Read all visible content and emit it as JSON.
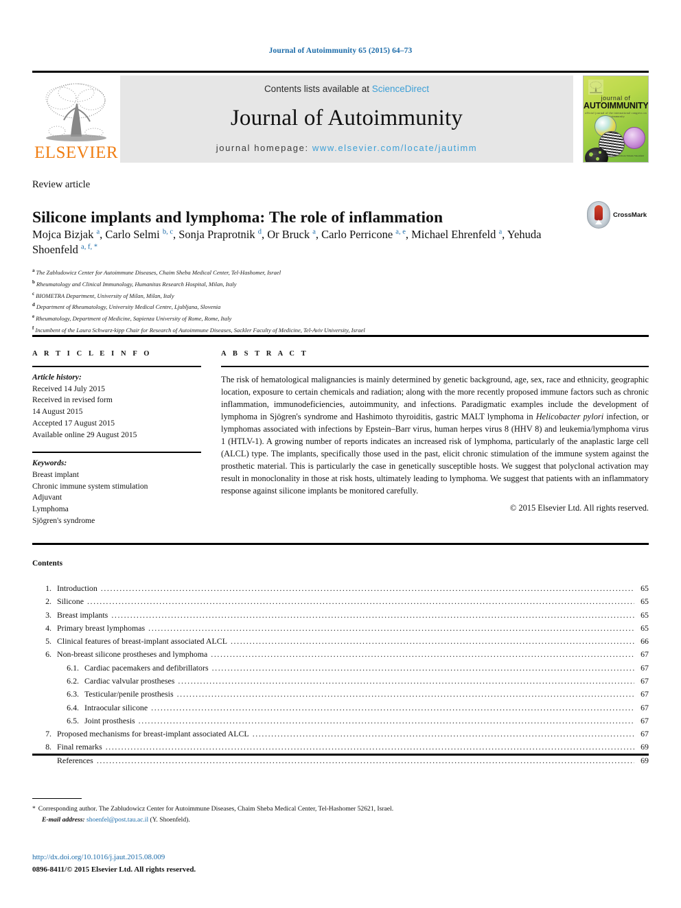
{
  "running_head": "Journal of Autoimmunity 65 (2015) 64–73",
  "masthead": {
    "contents_prefix": "Contents lists available at ",
    "sciencedirect": "ScienceDirect",
    "journal_title": "Journal of Autoimmunity",
    "homepage_prefix": "journal homepage: ",
    "homepage_url": "www.elsevier.com/locate/jautimm",
    "publisher_logo_text": "ELSEVIER",
    "cover": {
      "line1": "journal of",
      "line2": "AUTOIMMUNITY",
      "line3": "official journal of the international congress on autoimmunity",
      "footer": "Editors-in-Chief\nM. Eric Gershwin\nYehuda Shoenfeld"
    }
  },
  "article": {
    "type": "Review article",
    "title": "Silicone implants and lymphoma: The role of inflammation",
    "crossmark_label": "CrossMark",
    "authors": [
      {
        "name": "Mojca Bizjak",
        "marks": "a",
        "sep": ", "
      },
      {
        "name": "Carlo Selmi",
        "marks": "b, c",
        "sep": ", "
      },
      {
        "name": "Sonja Praprotnik",
        "marks": "d",
        "sep": ", "
      },
      {
        "name": "Or Bruck",
        "marks": "a",
        "sep": ", "
      },
      {
        "name": "Carlo Perricone",
        "marks": "a, e",
        "sep": ", "
      },
      {
        "name": "Michael Ehrenfeld",
        "marks": "a",
        "sep": ", "
      },
      {
        "name": "Yehuda Shoenfeld",
        "marks": "a, f, *",
        "sep": ""
      }
    ],
    "affiliations": [
      {
        "mark": "a",
        "text": "The Zabludowicz Center for Autoimmune Diseases, Chaim Sheba Medical Center, Tel-Hashomer, Israel"
      },
      {
        "mark": "b",
        "text": "Rheumatology and Clinical Immunology, Humanitas Research Hospital, Milan, Italy"
      },
      {
        "mark": "c",
        "text": "BIOMETRA Department, University of Milan, Milan, Italy"
      },
      {
        "mark": "d",
        "text": "Department of Rheumatology, University Medical Centre, Ljubljana, Slovenia"
      },
      {
        "mark": "e",
        "text": "Rheumatology, Department of Medicine, Sapienza University of Rome, Rome, Italy"
      },
      {
        "mark": "f",
        "text": "Incumbent of the Laura Schwarz-kipp Chair for Research of Autoimmune Diseases, Sackler Faculty of Medicine, Tel-Aviv University, Israel"
      }
    ]
  },
  "article_info": {
    "section_label": "A R T I C L E   I N F O",
    "history_label": "Article history:",
    "history": [
      "Received 14 July 2015",
      "Received in revised form",
      "14 August 2015",
      "Accepted 17 August 2015",
      "Available online 29 August 2015"
    ],
    "keywords_label": "Keywords:",
    "keywords": [
      "Breast implant",
      "Chronic immune system stimulation",
      "Adjuvant",
      "Lymphoma",
      "Sjögren's syndrome"
    ]
  },
  "abstract": {
    "section_label": "A B S T R A C T",
    "part1": "The risk of hematological malignancies is mainly determined by genetic background, age, sex, race and ethnicity, geographic location, exposure to certain chemicals and radiation; along with the more recently proposed immune factors such as chronic inflammation, immunodeficiencies, autoimmunity, and infections. Paradigmatic examples include the development of lymphoma in Sjögren's syndrome and Hashimoto thyroiditis, gastric MALT lymphoma in ",
    "italic1": "Helicobacter pylori",
    "part2": " infection, or lymphomas associated with infections by Epstein–Barr virus, human herpes virus 8 (HHV 8) and leukemia/lymphoma virus 1 (HTLV-1). A growing number of reports indicates an increased risk of lymphoma, particularly of the anaplastic large cell (ALCL) type. The implants, specifically those used in the past, elicit chronic stimulation of the immune system against the prosthetic material. This is particularly the case in genetically susceptible hosts. We suggest that polyclonal activation may result in monoclonality in those at risk hosts, ultimately leading to lymphoma. We suggest that patients with an inflammatory response against silicone implants be monitored carefully.",
    "copyright": "© 2015 Elsevier Ltd. All rights reserved."
  },
  "contents": {
    "heading": "Contents",
    "items": [
      {
        "num": "1.",
        "level": 1,
        "label": "Introduction",
        "page": "65"
      },
      {
        "num": "2.",
        "level": 1,
        "label": "Silicone",
        "page": "65"
      },
      {
        "num": "3.",
        "level": 1,
        "label": "Breast implants",
        "page": "65"
      },
      {
        "num": "4.",
        "level": 1,
        "label": "Primary breast lymphomas",
        "page": "65"
      },
      {
        "num": "5.",
        "level": 1,
        "label": "Clinical features of breast-implant associated ALCL",
        "page": "66"
      },
      {
        "num": "6.",
        "level": 1,
        "label": "Non-breast silicone prostheses and lymphoma",
        "page": "67"
      },
      {
        "num": "6.1.",
        "level": 2,
        "label": "Cardiac pacemakers and defibrillators",
        "page": "67"
      },
      {
        "num": "6.2.",
        "level": 2,
        "label": "Cardiac valvular prostheses",
        "page": "67"
      },
      {
        "num": "6.3.",
        "level": 2,
        "label": "Testicular/penile prosthesis",
        "page": "67"
      },
      {
        "num": "6.4.",
        "level": 2,
        "label": "Intraocular silicone",
        "page": "67"
      },
      {
        "num": "6.5.",
        "level": 2,
        "label": "Joint prosthesis",
        "page": "67"
      },
      {
        "num": "7.",
        "level": 1,
        "label": "Proposed mechanisms for breast-implant associated ALCL",
        "page": "67"
      },
      {
        "num": "8.",
        "level": 1,
        "label": "Final remarks",
        "page": "69"
      },
      {
        "num": "",
        "level": 1,
        "label": "References",
        "page": "69"
      }
    ]
  },
  "footer": {
    "star": "*",
    "corresponding": "Corresponding author. The Zabludowicz Center for Autoimmune Diseases, Chaim Sheba Medical Center, Tel-Hashomer 52621, Israel.",
    "email_label": "E-mail address:",
    "email": "shoenfel@post.tau.ac.il",
    "email_owner": "(Y. Shoenfeld).",
    "doi": "http://dx.doi.org/10.1016/j.jaut.2015.08.009",
    "issn": "0896-8411/© 2015 Elsevier Ltd. All rights reserved."
  },
  "colors": {
    "link_blue": "#1a6aa8",
    "sciencedirect_blue": "#3c9fd6",
    "elsevier_orange": "#f07e13",
    "masthead_grey": "#e6e6e6"
  }
}
